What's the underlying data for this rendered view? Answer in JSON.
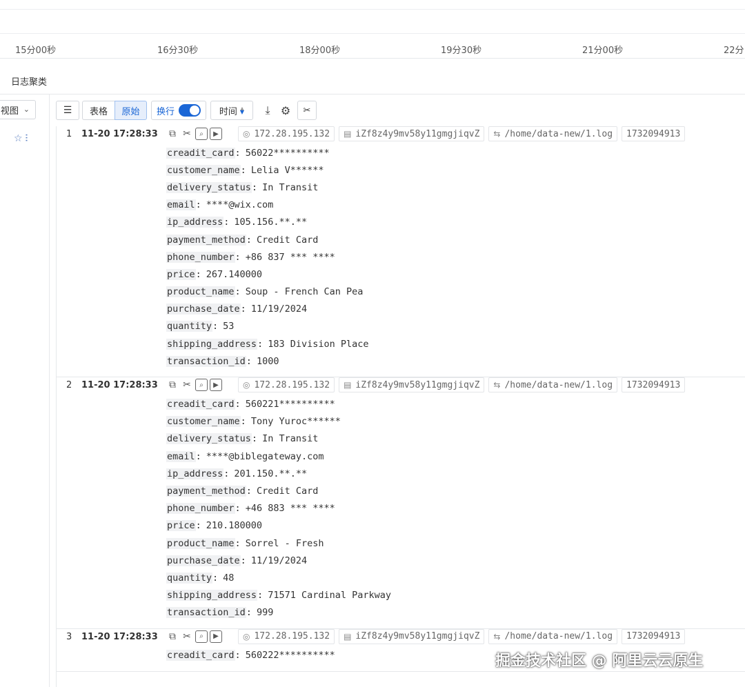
{
  "axis": {
    "labels": [
      "15分00秒",
      "16分30秒",
      "18分00秒",
      "19分30秒",
      "21分00秒",
      "22分"
    ]
  },
  "section_title": "日志聚类",
  "sidebar": {
    "view_select": "视图",
    "chevron": "⌄",
    "icons": [
      "star-icon",
      "filter-settings-icon"
    ]
  },
  "toolbar": {
    "collapse": "☰",
    "table_tab": "表格",
    "raw_tab": "原始",
    "wrap_label": "换行",
    "wrap_on": true,
    "time_label": "时间",
    "download_icon": "⤓",
    "settings_icon": "⚙",
    "tools_icon": "✂"
  },
  "logs": [
    {
      "num": "1",
      "time": "11-20 17:28:33",
      "ip": "172.28.195.132",
      "host": "iZf8z4y9mv58y11gmgjiqvZ",
      "path": "/home/data-new/1.log",
      "ts": "1732094913",
      "fields": [
        {
          "k": "creadit_card",
          "v": "56022**********"
        },
        {
          "k": "customer_name",
          "v": "Lelia V******"
        },
        {
          "k": "delivery_status",
          "v": "In Transit"
        },
        {
          "k": "email",
          "v": "****@wix.com"
        },
        {
          "k": "ip_address",
          "v": "105.156.**.**"
        },
        {
          "k": "payment_method",
          "v": "Credit Card"
        },
        {
          "k": "phone_number",
          "v": "+86 837 *** ****"
        },
        {
          "k": "price",
          "v": "267.140000"
        },
        {
          "k": "product_name",
          "v": "Soup - French Can Pea"
        },
        {
          "k": "purchase_date",
          "v": "11/19/2024"
        },
        {
          "k": "quantity",
          "v": "53"
        },
        {
          "k": "shipping_address",
          "v": "183 Division Place"
        },
        {
          "k": "transaction_id",
          "v": "1000"
        }
      ]
    },
    {
      "num": "2",
      "time": "11-20 17:28:33",
      "ip": "172.28.195.132",
      "host": "iZf8z4y9mv58y11gmgjiqvZ",
      "path": "/home/data-new/1.log",
      "ts": "1732094913",
      "fields": [
        {
          "k": "creadit_card",
          "v": "560221**********"
        },
        {
          "k": "customer_name",
          "v": "Tony Yuroc******"
        },
        {
          "k": "delivery_status",
          "v": "In Transit"
        },
        {
          "k": "email",
          "v": "****@biblegateway.com"
        },
        {
          "k": "ip_address",
          "v": "201.150.**.**"
        },
        {
          "k": "payment_method",
          "v": "Credit Card"
        },
        {
          "k": "phone_number",
          "v": "+46 883 *** ****"
        },
        {
          "k": "price",
          "v": "210.180000"
        },
        {
          "k": "product_name",
          "v": "Sorrel - Fresh"
        },
        {
          "k": "purchase_date",
          "v": "11/19/2024"
        },
        {
          "k": "quantity",
          "v": "48"
        },
        {
          "k": "shipping_address",
          "v": "71571 Cardinal Parkway"
        },
        {
          "k": "transaction_id",
          "v": "999"
        }
      ]
    },
    {
      "num": "3",
      "time": "11-20 17:28:33",
      "ip": "172.28.195.132",
      "host": "iZf8z4y9mv58y11gmgjiqvZ",
      "path": "/home/data-new/1.log",
      "ts": "1732094913",
      "fields": [
        {
          "k": "creadit_card",
          "v": "560222**********"
        }
      ]
    }
  ],
  "watermark": "掘金技术社区 @ 阿里云云原生"
}
